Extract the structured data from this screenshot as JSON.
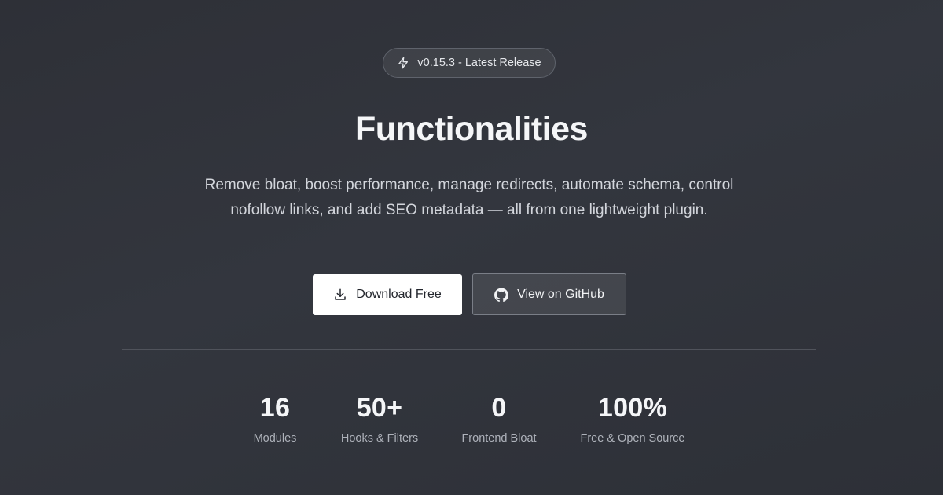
{
  "badge": {
    "icon": "lightning-icon",
    "label": "v0.15.3 - Latest Release"
  },
  "hero": {
    "title": "Functionalities",
    "description": "Remove bloat, boost performance, manage redirects, automate schema, control nofollow links, and add SEO metadata — all from one lightweight plugin."
  },
  "buttons": {
    "download": {
      "icon": "download-icon",
      "label": "Download Free"
    },
    "github": {
      "icon": "github-icon",
      "label": "View on GitHub"
    }
  },
  "stats": [
    {
      "value": "16",
      "label": "Modules"
    },
    {
      "value": "50+",
      "label": "Hooks & Filters"
    },
    {
      "value": "0",
      "label": "Frontend Bloat"
    },
    {
      "value": "100%",
      "label": "Free & Open Source"
    }
  ],
  "colors": {
    "background": "#30333a",
    "primary_button": "#ffffff",
    "text": "#f5f6f8",
    "muted_text": "#aeb2ba"
  }
}
